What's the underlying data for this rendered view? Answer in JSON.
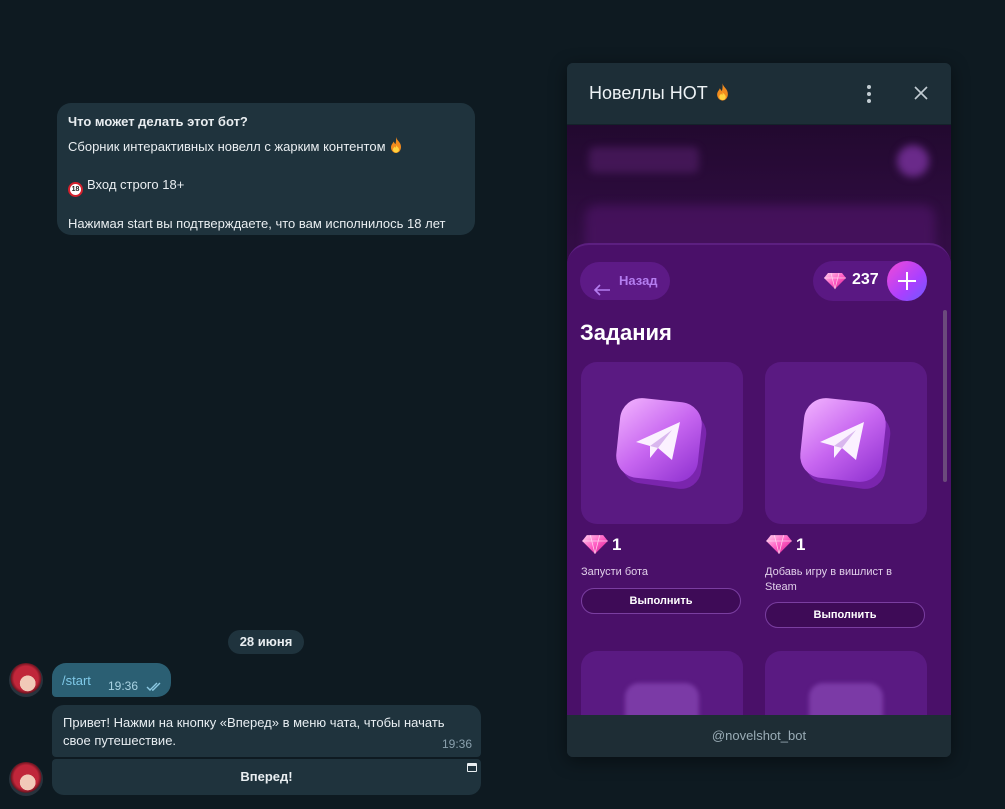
{
  "chat": {
    "bot_info": {
      "title": "Что может делать этот бот?",
      "description": "Сборник интерактивных новелл с жарким контентом",
      "age_badge": "18",
      "age_notice": "Вход строго 18+",
      "consent": "Нажимая start вы подтверждаете, что вам исполнилось 18 лет"
    },
    "date_separator": "28 июня",
    "outgoing": {
      "text": "/start",
      "time": "19:36"
    },
    "incoming": {
      "text": "Привет! Нажми на кнопку «Вперед» в меню чата, чтобы начать свое путешествие.",
      "time": "19:36"
    },
    "keyboard_button": "Вперед!"
  },
  "mini_app": {
    "title": "Новеллы HOT",
    "footer": "@novelshot_bot",
    "back_label": "Назад",
    "balance": "237",
    "section_title": "Задания",
    "tasks": [
      {
        "reward": "1",
        "description": "Запусти бота",
        "button": "Выполнить"
      },
      {
        "reward": "1",
        "description": "Добавь игру в вишлист в Steam",
        "button": "Выполнить"
      }
    ]
  },
  "colors": {
    "chat_bg": "#0e1a21",
    "bubble": "#1f333d",
    "outgoing_bubble": "#2b5f73",
    "app_purple": "#4a1069",
    "accent_pink": "#f24ad7"
  },
  "icons": [
    "fire-icon",
    "no-under-18-icon",
    "read-ticks-icon",
    "inline-keyboard-icon",
    "more-vertical-icon",
    "close-icon",
    "arrow-left-icon",
    "gem-icon",
    "plus-icon",
    "telegram-icon"
  ]
}
